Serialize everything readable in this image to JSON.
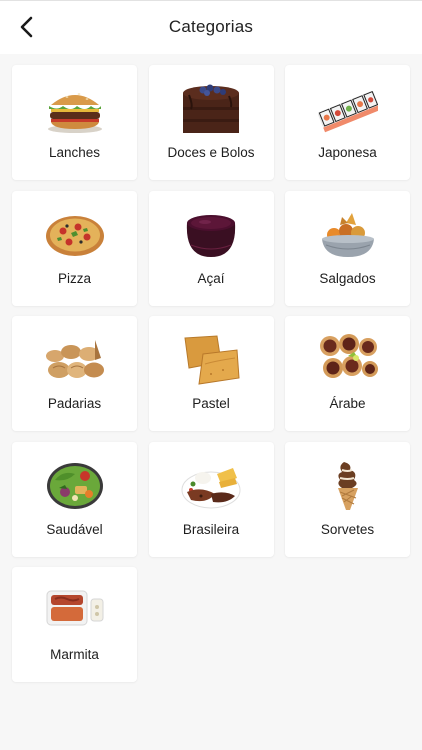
{
  "header": {
    "title": "Categorias",
    "back_icon": "chevron-left-icon"
  },
  "categories": [
    {
      "label": "Lanches",
      "icon": "burger-icon"
    },
    {
      "label": "Doces e Bolos",
      "icon": "cake-icon"
    },
    {
      "label": "Japonesa",
      "icon": "sushi-icon"
    },
    {
      "label": "Pizza",
      "icon": "pizza-icon"
    },
    {
      "label": "Açaí",
      "icon": "acai-bowl-icon"
    },
    {
      "label": "Salgados",
      "icon": "snacks-bowl-icon"
    },
    {
      "label": "Padarias",
      "icon": "bread-icon"
    },
    {
      "label": "Pastel",
      "icon": "pastel-icon"
    },
    {
      "label": "Árabe",
      "icon": "esfiha-icon"
    },
    {
      "label": "Saudável",
      "icon": "salad-icon"
    },
    {
      "label": "Brasileira",
      "icon": "brazilian-plate-icon"
    },
    {
      "label": "Sorvetes",
      "icon": "ice-cream-icon"
    },
    {
      "label": "Marmita",
      "icon": "lunchbox-icon"
    }
  ]
}
